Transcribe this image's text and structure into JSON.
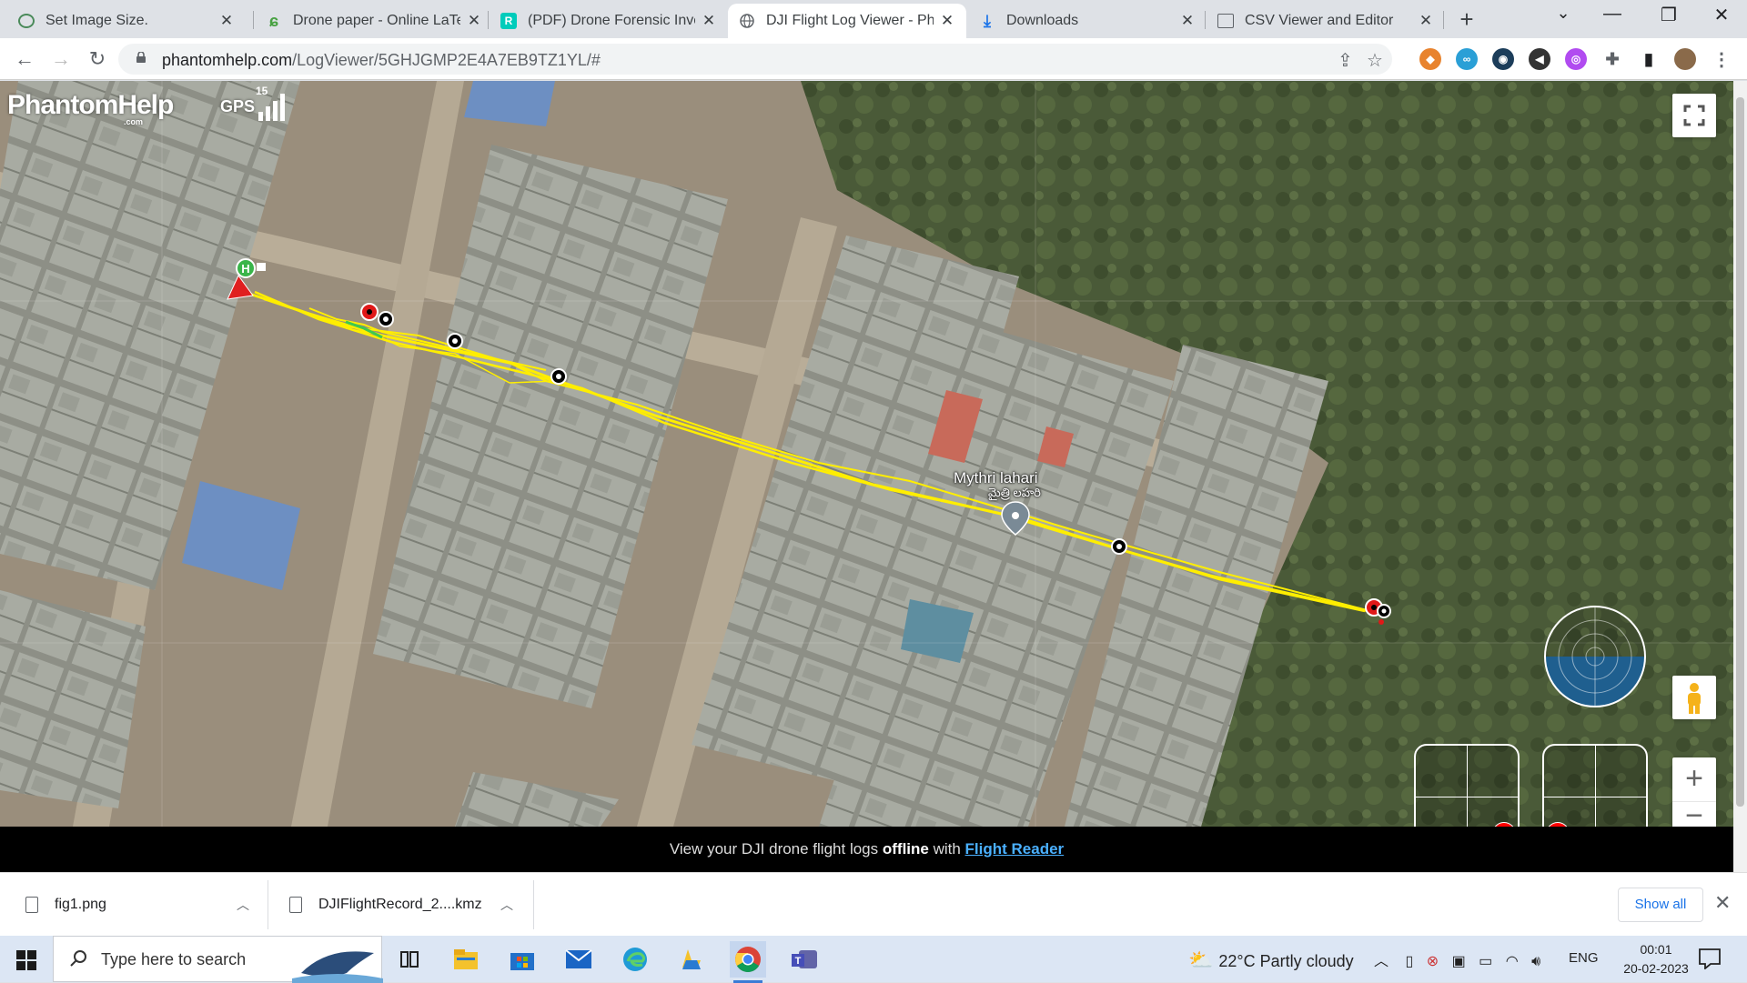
{
  "browser": {
    "tabs": [
      {
        "title": "Set Image Size.",
        "favicon": "image-tool-icon",
        "active": false
      },
      {
        "title": "Drone paper - Online LaTeX",
        "favicon": "overleaf-icon",
        "active": false
      },
      {
        "title": "(PDF) Drone Forensic Invest",
        "favicon": "researchgate-icon",
        "active": false
      },
      {
        "title": "DJI Flight Log Viewer - Phan",
        "favicon": "globe-icon",
        "active": true
      },
      {
        "title": "Downloads",
        "favicon": "download-icon",
        "active": false
      },
      {
        "title": "CSV Viewer and Editor",
        "favicon": "csv-icon",
        "active": false
      }
    ],
    "new_tab": "+",
    "window_controls": {
      "dropdown": "⌄",
      "minimize": "—",
      "maximize": "❐",
      "close": "✕"
    },
    "url_host": "phantomhelp.com",
    "url_path": "/LogViewer/5GHJGMP2E4A7EB9TZ1YL/#"
  },
  "map": {
    "logo_text": "PhantomHelp",
    "logo_sub": ".com",
    "gps_label": "GPS",
    "gps_satellites": "15",
    "poi_name": "Mythri lahari",
    "poi_native": "మైత్రి లహరి",
    "home_marker": "H",
    "zoom_in": "+",
    "zoom_out": "−"
  },
  "promo": {
    "prefix": "View your DJI drone flight logs ",
    "bold": "offline",
    "middle": " with ",
    "link": "Flight Reader"
  },
  "downloads": {
    "items": [
      {
        "name": "fig1.png"
      },
      {
        "name": "DJIFlightRecord_2....kmz"
      }
    ],
    "show_all": "Show all",
    "close": "✕"
  },
  "taskbar": {
    "search_placeholder": "Type here to search",
    "weather": "22°C  Partly cloudy",
    "lang": "ENG",
    "time": "00:01",
    "date": "20-02-2023",
    "apps": [
      "task-view-icon",
      "file-explorer-icon",
      "microsoft-store-icon",
      "mail-icon",
      "edge-icon",
      "files-folder-icon",
      "chrome-icon",
      "teams-icon"
    ]
  },
  "colors": {
    "flight_path": "#ffee00",
    "tab_strip": "#dee1e6",
    "taskbar": "#dce6f4",
    "link": "#4ab0ff"
  }
}
